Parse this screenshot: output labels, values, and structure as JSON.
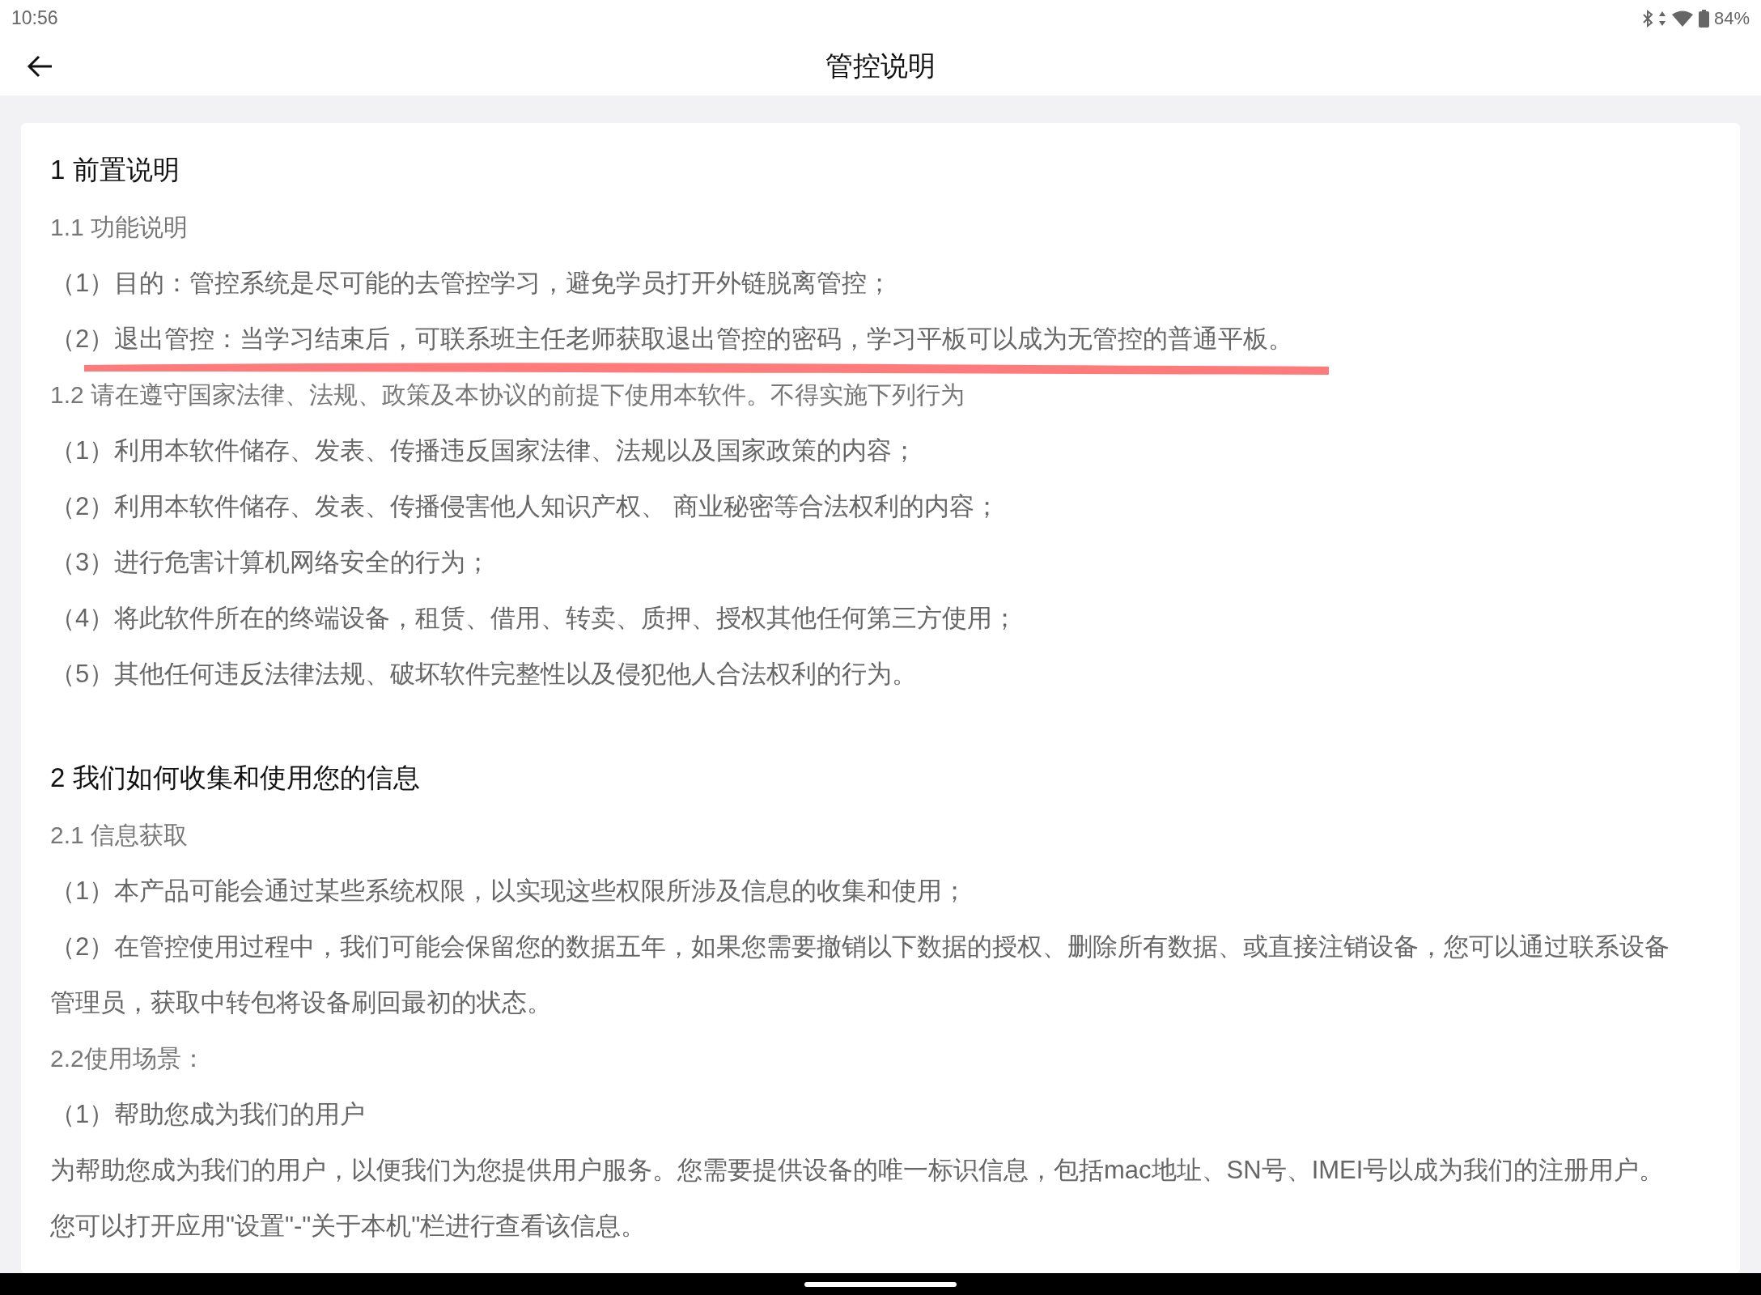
{
  "status_bar": {
    "time": "10:56",
    "battery": "84%"
  },
  "header": {
    "title": "管控说明"
  },
  "sections": [
    {
      "heading": "1 前置说明",
      "blocks": [
        {
          "kind": "subheading",
          "text": "1.1 功能说明"
        },
        {
          "kind": "body",
          "text": "（1）目的：管控系统是尽可能的去管控学习，避免学员打开外链脱离管控；",
          "underlined": false
        },
        {
          "kind": "body",
          "text": "（2）退出管控：当学习结束后，可联系班主任老师获取退出管控的密码，学习平板可以成为无管控的普通平板。",
          "underlined": true
        },
        {
          "kind": "subheading",
          "text": "1.2 请在遵守国家法律、法规、政策及本协议的前提下使用本软件。不得实施下列行为"
        },
        {
          "kind": "body",
          "text": "（1）利用本软件储存、发表、传播违反国家法律、法规以及国家政策的内容；",
          "underlined": false
        },
        {
          "kind": "body",
          "text": "（2）利用本软件储存、发表、传播侵害他人知识产权、 商业秘密等合法权利的内容；",
          "underlined": false
        },
        {
          "kind": "body",
          "text": "（3）进行危害计算机网络安全的行为；",
          "underlined": false
        },
        {
          "kind": "body",
          "text": "（4）将此软件所在的终端设备，租赁、借用、转卖、质押、授权其他任何第三方使用；",
          "underlined": false
        },
        {
          "kind": "body",
          "text": "（5）其他任何违反法律法规、破坏软件完整性以及侵犯他人合法权利的行为。",
          "underlined": false
        }
      ]
    },
    {
      "heading": "2 我们如何收集和使用您的信息",
      "blocks": [
        {
          "kind": "subheading",
          "text": "2.1 信息获取"
        },
        {
          "kind": "body",
          "text": "（1）本产品可能会通过某些系统权限，以实现这些权限所涉及信息的收集和使用；",
          "underlined": false
        },
        {
          "kind": "body",
          "text": "（2）在管控使用过程中，我们可能会保留您的数据五年，如果您需要撤销以下数据的授权、删除所有数据、或直接注销设备，您可以通过联系设备管理员，获取中转包将设备刷回最初的状态。",
          "underlined": false
        },
        {
          "kind": "subheading",
          "text": "2.2使用场景："
        },
        {
          "kind": "body",
          "text": "（1）帮助您成为我们的用户",
          "underlined": false
        },
        {
          "kind": "body",
          "text": "为帮助您成为我们的用户，以便我们为您提供用户服务。您需要提供设备的唯一标识信息，包括mac地址、SN号、IMEI号以成为我们的注册用户。",
          "underlined": false
        },
        {
          "kind": "body",
          "text": "您可以打开应用\"设置\"-\"关于本机\"栏进行查看该信息。",
          "underlined": false
        }
      ]
    }
  ]
}
